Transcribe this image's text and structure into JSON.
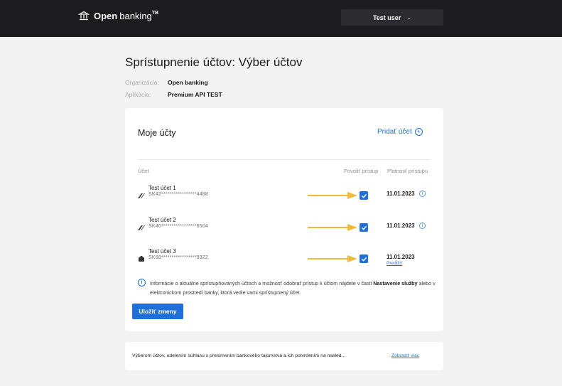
{
  "header": {
    "logo_brand": "Open",
    "logo_rest": "banking",
    "logo_sup": "TB",
    "user_label": "Test user",
    "user_chevron": "⌄"
  },
  "page": {
    "title": "Sprístupnenie účtov: Výber účtov",
    "organization_label": "Organizácia:",
    "organization_value": "Open banking",
    "application_label": "Aplikácia:",
    "application_value": "Premium API TEST"
  },
  "accounts_card": {
    "title": "Moje účty",
    "add_label": "Pridať účet",
    "add_icon": "plus-circle-icon",
    "columns": {
      "account": "Účet",
      "allow_access": "Povoliť prístup",
      "validity": "Platnosť prístupu"
    },
    "rows": [
      {
        "name": "Test účet 1",
        "iban": "SK42*****************4488",
        "icon": "card-icon",
        "checked": true,
        "valid_until": "11.01.2023",
        "has_info": true,
        "extend_label": ""
      },
      {
        "name": "Test účet 2",
        "iban": "SK40*****************6504",
        "icon": "card-icon",
        "checked": true,
        "valid_until": "11.01.2023",
        "has_info": true,
        "extend_label": ""
      },
      {
        "name": "Test účet 3",
        "iban": "SK68*****************9322",
        "icon": "piggy-bank-icon",
        "checked": true,
        "valid_until": "11.01.2023",
        "has_info": false,
        "extend_label": "Predĺžiť"
      }
    ],
    "notice_prefix": "Informácie o aktuálne sprístupňovaných účtoch a možnosť odobrať prístup k účtom nájdete v časti ",
    "notice_bold": "Nastavenie služby",
    "notice_suffix": " alebo v elektronickom prostredí banky, ktorá vedie vami sprístupnený účet.",
    "save_label": "Uložiť zmeny"
  },
  "consent": {
    "text": "Výberom účtov, udelením súhlasu s prelomením bankového tajomstva a ich potvrdením na nasled...",
    "more_label": "Zobraziť viac"
  },
  "colors": {
    "accent": "#1e6fd9",
    "arrow": "#f2b93b",
    "topbar": "#1c1c1e"
  }
}
